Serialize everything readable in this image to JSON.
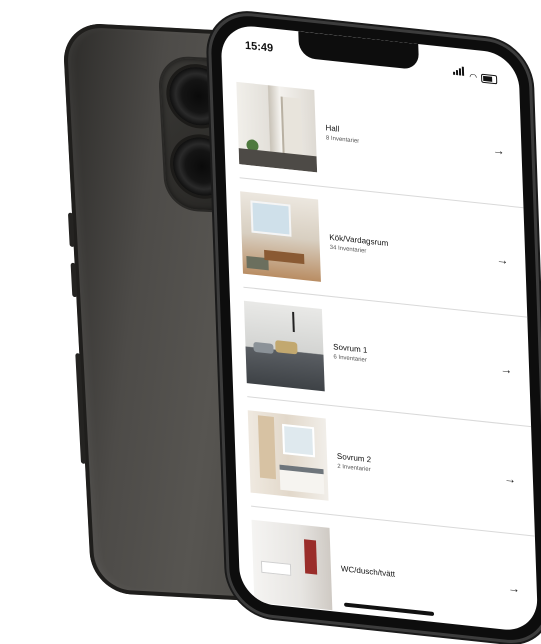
{
  "status_bar": {
    "time": "15:49"
  },
  "rooms": [
    {
      "name": "Hall",
      "count": "8 Inventarier",
      "arrow": "→"
    },
    {
      "name": "Kök/Vardagsrum",
      "count": "34 Inventarier",
      "arrow": "→"
    },
    {
      "name": "Sovrum 1",
      "count": "6 Inventarier",
      "arrow": "→"
    },
    {
      "name": "Sovrum 2",
      "count": "2 Inventarier",
      "arrow": "→"
    },
    {
      "name": "WC/dusch/tvätt",
      "count": "",
      "arrow": "→"
    }
  ],
  "icons": {
    "signal": "signal-icon",
    "wifi": "wifi-icon",
    "battery": "battery-icon",
    "arrow": "arrow-right-icon"
  },
  "colors": {
    "phone_body": "#4d4b48",
    "screen_bg": "#ffffff",
    "text": "#111111",
    "divider": "#d9d9d9"
  }
}
